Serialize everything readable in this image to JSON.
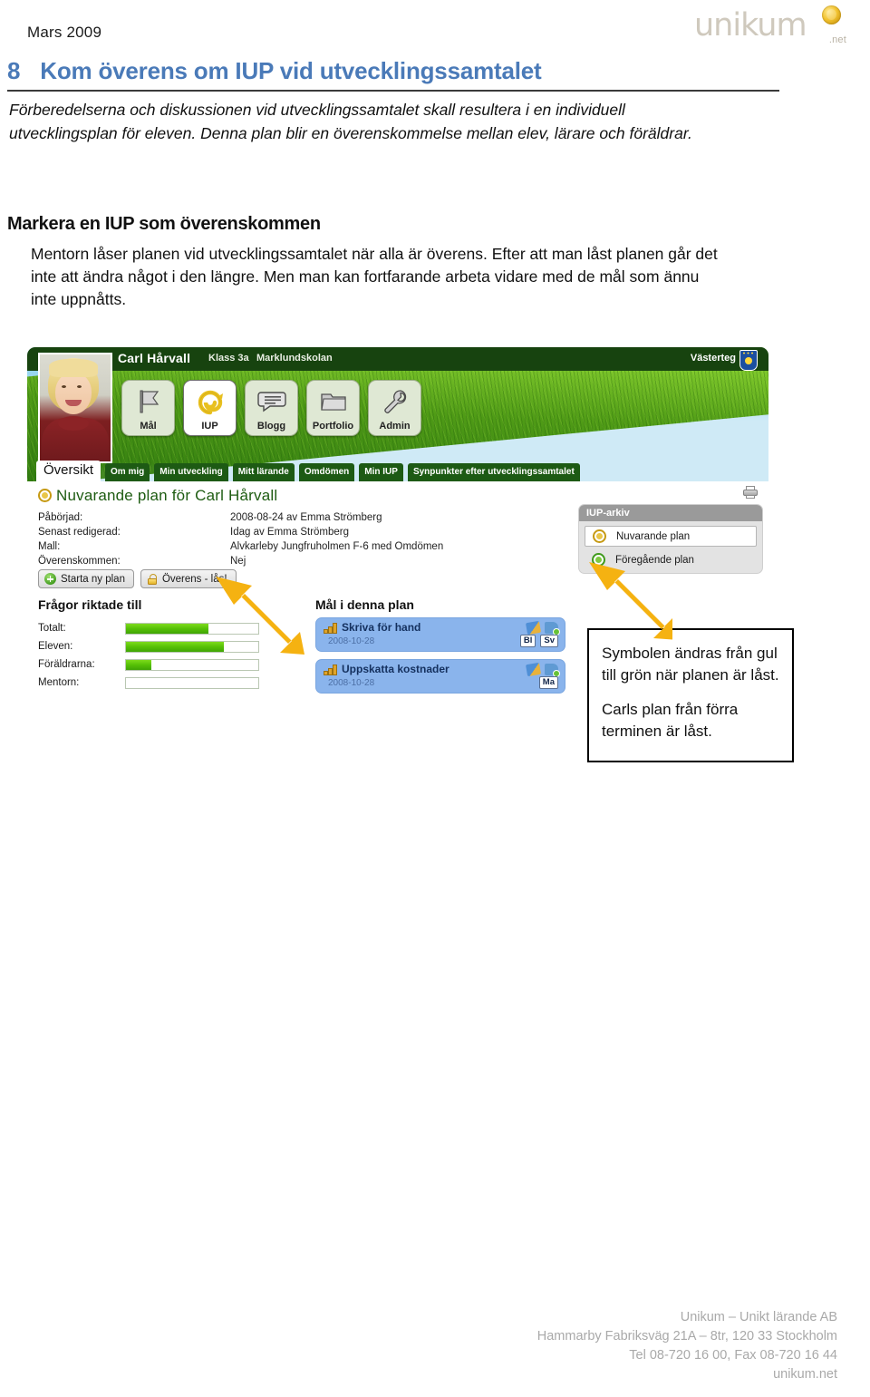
{
  "page": {
    "date": "Mars 2009",
    "logo_word": "unikum",
    "logo_suffix": ".net"
  },
  "section": {
    "number": "8",
    "title": "Kom överens om IUP vid utvecklingssamtalet",
    "intro": "Förberedelserna och diskussionen vid utvecklingssamtalet skall resultera i en individuell utvecklingsplan för eleven. Denna plan blir en överenskommelse mellan elev, lärare och föräldrar.",
    "subheading": "Markera en IUP som överenskommen",
    "body": "Mentorn låser planen vid utvecklingssamtalet när alla är överens. Efter att man låst planen går det inte att ändra något i den längre. Men man kan fortfarande arbeta vidare med de mål som ännu inte uppnåtts."
  },
  "screenshot": {
    "student": {
      "name": "Carl Hårvall",
      "klass": "Klass 3a",
      "school": "Marklundskolan"
    },
    "municipality": "Västerteg",
    "icon_buttons": [
      {
        "label": "Mål",
        "icon": "flag-icon",
        "active": false
      },
      {
        "label": "IUP",
        "icon": "spiral-icon",
        "active": true
      },
      {
        "label": "Blogg",
        "icon": "speech-bubble-icon",
        "active": false
      },
      {
        "label": "Portfolio",
        "icon": "folder-icon",
        "active": false
      },
      {
        "label": "Admin",
        "icon": "wrench-icon",
        "active": false
      }
    ],
    "tabs": [
      {
        "label": "Översikt",
        "active": true
      },
      {
        "label": "Om mig",
        "active": false
      },
      {
        "label": "Min utveckling",
        "active": false
      },
      {
        "label": "Mitt lärande",
        "active": false
      },
      {
        "label": "Omdömen",
        "active": false
      },
      {
        "label": "Min IUP",
        "active": false
      },
      {
        "label": "Synpunkter efter utvecklingssamtalet",
        "active": false
      }
    ],
    "plan_title": "Nuvarande plan för Carl Hårvall",
    "meta": [
      {
        "label": "Påbörjad:",
        "value": "2008-08-24 av Emma Strömberg"
      },
      {
        "label": "Senast redigerad:",
        "value": "Idag av Emma Strömberg"
      },
      {
        "label": "Mall:",
        "value": "Alvkarleby Jungfruholmen F-6 med Omdömen"
      },
      {
        "label": "Överenskommen:",
        "value": "Nej"
      }
    ],
    "buttons": [
      {
        "label": "Starta ny plan",
        "icon": "plus-circle-icon"
      },
      {
        "label": "Överens - lås!",
        "icon": "lock-icon"
      }
    ],
    "questions": {
      "header": "Frågor riktade till",
      "rows": [
        {
          "label": "Totalt:",
          "percent": 62
        },
        {
          "label": "Eleven:",
          "percent": 74
        },
        {
          "label": "Föräldrarna:",
          "percent": 19
        },
        {
          "label": "Mentorn:",
          "percent": 0
        }
      ]
    },
    "goals": {
      "header": "Mål i denna plan",
      "items": [
        {
          "title": "Skriva för hand",
          "date": "2008-10-28",
          "subjects": [
            "Bl",
            "Sv"
          ]
        },
        {
          "title": "Uppskatta kostnader",
          "date": "2008-10-28",
          "subjects": [
            "Ma"
          ]
        }
      ]
    },
    "archive": {
      "header": "IUP-arkiv",
      "items": [
        {
          "label": "Nuvarande plan",
          "state": "current",
          "symbol_color": "#e9c64a"
        },
        {
          "label": "Föregående plan",
          "state": "previous",
          "symbol_color": "#7ec941"
        }
      ]
    },
    "print_icon": "printer-icon"
  },
  "callout": {
    "paragraph1": "Symbolen ändras från gul till grön när planen är låst.",
    "paragraph2": "Carls plan från förra terminen är låst."
  },
  "footer": {
    "line1": "Unikum – Unikt lärande AB",
    "line2": "Hammarby Fabriksväg 21A – 8tr, 120 33 Stockholm",
    "line3": "Tel 08-720 16 00, Fax 08-720 16 44",
    "line4": "unikum.net"
  },
  "colors": {
    "heading_blue": "#4a7ab8",
    "banner_green": "#17430f",
    "tab_green": "#1d5a14",
    "bar_green": "#56c006",
    "goal_blue": "#8ab4ec",
    "arrow_yellow": "#f5b211"
  }
}
